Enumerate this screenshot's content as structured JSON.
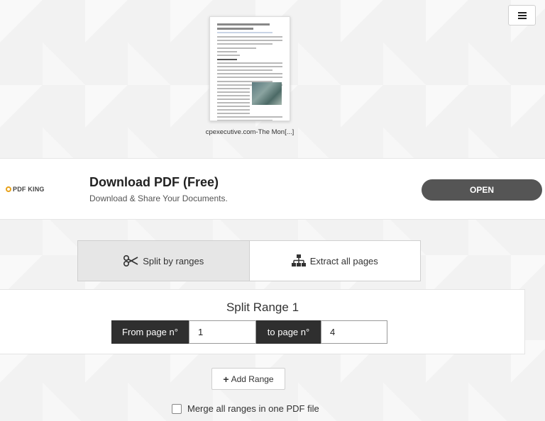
{
  "file": {
    "name": "cpexecutive.com-The Mon[...]"
  },
  "ad": {
    "brand": "PDF KING",
    "title": "Download PDF (Free)",
    "subtitle": "Download & Share Your Documents.",
    "button": "OPEN"
  },
  "tabs": [
    {
      "label": "Split by ranges",
      "icon": "scissors-icon",
      "active": true
    },
    {
      "label": "Extract all pages",
      "icon": "sitemap-icon",
      "active": false
    }
  ],
  "range": {
    "title": "Split Range 1",
    "from_label": "From page n°",
    "from_value": "1",
    "to_label": "to page n°",
    "to_value": "4"
  },
  "add_range_label": "Add Range",
  "merge_label": "Merge all ranges in one PDF file",
  "colors": {
    "ad_button": "#555555",
    "range_label_bg": "#2f2f2f",
    "active_tab": "#e6e6e6"
  }
}
